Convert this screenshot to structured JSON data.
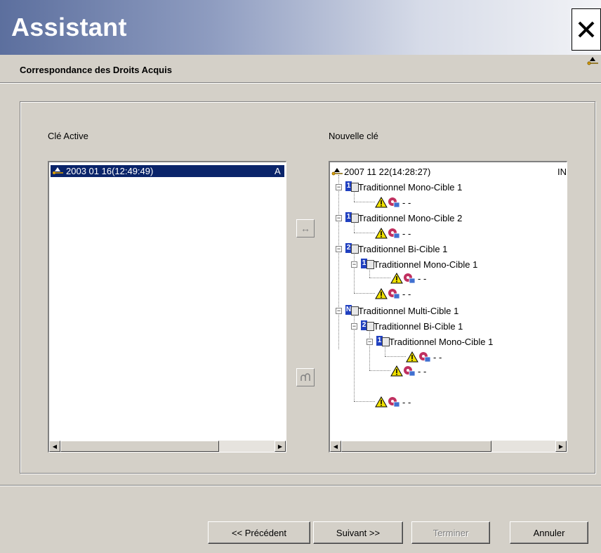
{
  "window": {
    "title": "Assistant",
    "subtitle": "Correspondance des Droits Acquis"
  },
  "left": {
    "label": "Clé Active",
    "items": [
      {
        "text": "2003 01 16(12:49:49)",
        "suffix": "A"
      }
    ]
  },
  "right": {
    "label": "Nouvelle clé",
    "root": {
      "text": "2007 11 22(14:28:27)",
      "suffix": "IN"
    },
    "nodes": {
      "n1": "Traditionnel Mono-Cible 1",
      "n1a": "- -",
      "n2": "Traditionnel Mono-Cible 2",
      "n2a": "- -",
      "n3": "Traditionnel Bi-Cible 1",
      "n3a": "Traditionnel Mono-Cible 1",
      "n3b": "- -",
      "n3c": "- -",
      "n4": "Traditionnel Multi-Cible 1",
      "n4a": "Traditionnel Bi-Cible 1",
      "n4b": "Traditionnel Mono-Cible 1",
      "n4c": "- -",
      "n4d": "- -",
      "n4e": "- -"
    },
    "badges": {
      "n1": "1",
      "n2": "1",
      "n3": "2",
      "n3a": "1",
      "n4": "N",
      "n4a": "2",
      "n4b": "1"
    }
  },
  "buttons": {
    "previous": "<< Précédent",
    "next": "Suivant >>",
    "finish": "Terminer",
    "cancel": "Annuler"
  },
  "icons": {
    "close": "close-icon",
    "key": "key-icon",
    "link": "link-icon",
    "unlink": "unlink-icon",
    "warning": "warning-icon",
    "disc": "disc-icon"
  }
}
